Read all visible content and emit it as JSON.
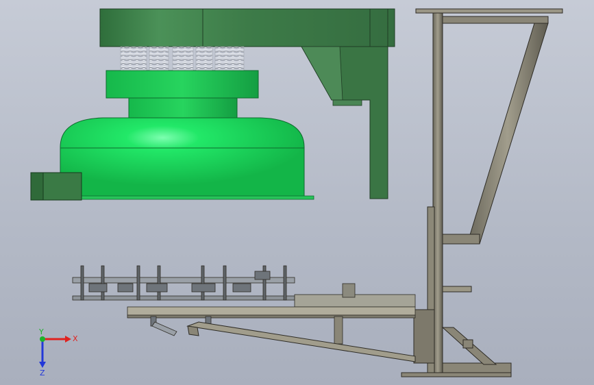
{
  "view": {
    "colors": {
      "background_top": "#c6cbd6",
      "background_bottom": "#a9afbd",
      "hopper_green": "#3f7f4a",
      "bowl_green": "#1fd35a",
      "frame_gray": "#8a8677",
      "spring_silver": "#d8dbe0"
    }
  },
  "triad": {
    "x_label": "X",
    "y_label": "Y",
    "z_label": "Z",
    "x_color": "#e0221f",
    "y_color": "#1db32a",
    "z_color": "#2338d8"
  },
  "model": {
    "parts": [
      "hopper-housing",
      "hopper-chute",
      "spring-set",
      "vibratory-bowl",
      "motor-box",
      "support-frame",
      "conveyor-track",
      "diagonal-brace"
    ]
  }
}
